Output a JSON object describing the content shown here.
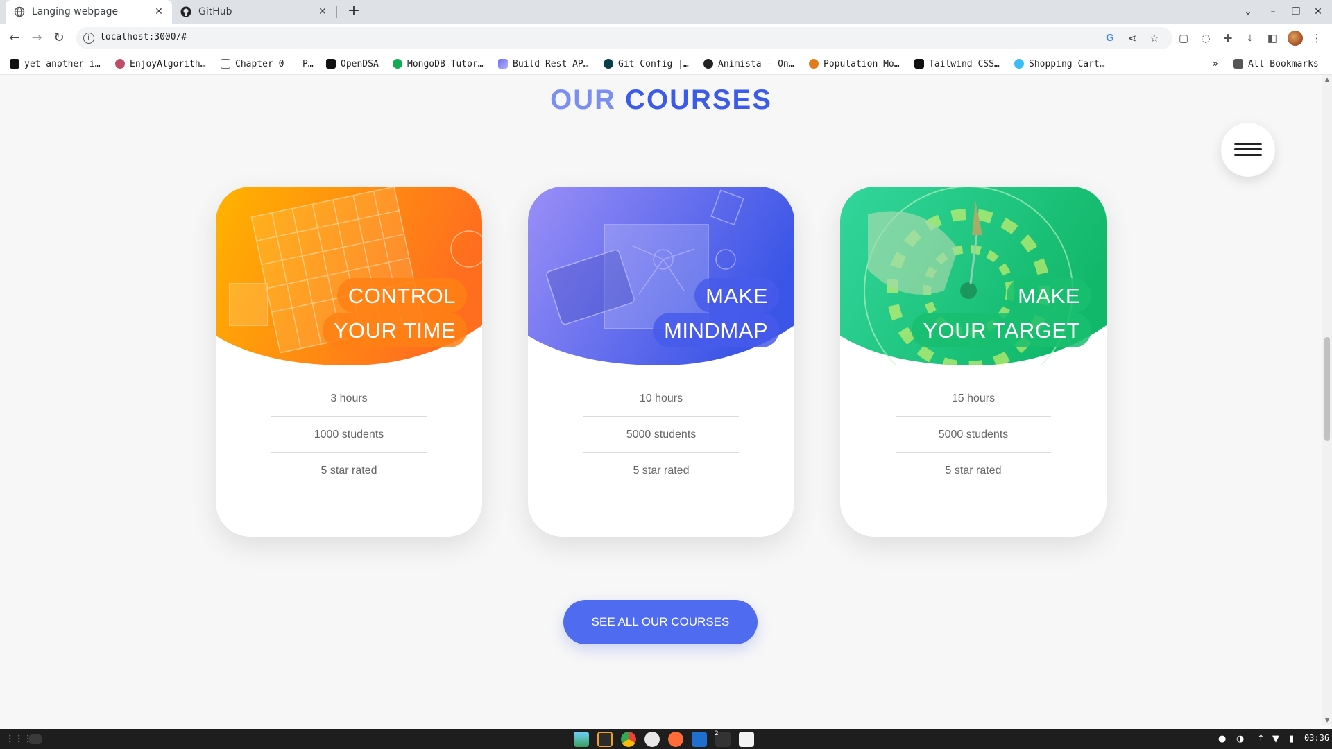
{
  "browser": {
    "tabs": [
      {
        "title": "Langing webpage",
        "active": true
      },
      {
        "title": "GitHub",
        "active": false
      }
    ],
    "url": "localhost:3000/#",
    "bookmarks": [
      "yet another i…",
      "EnjoyAlgorith…",
      "Chapter 0",
      "P…",
      "OpenDSA",
      "MongoDB Tutor…",
      "Build Rest AP…",
      "Git Config |…",
      "Animista - On…",
      "Population Mo…",
      "Tailwind CSS…",
      "Shopping Cart…"
    ],
    "bookmarks_overflow": "»",
    "all_bookmarks": "All Bookmarks"
  },
  "page": {
    "heading_part1": "OUR",
    "heading_part2": "COURSES",
    "cta_label": "SEE ALL OUR COURSES",
    "cards": [
      {
        "title_line1": "CONTROL",
        "title_line2": "YOUR TIME",
        "theme": "orange",
        "colors": [
          "#ffb000",
          "#ff7a1a"
        ],
        "stats": [
          "3 hours",
          "1000 students",
          "5 star rated"
        ]
      },
      {
        "title_line1": "MAKE",
        "title_line2": "MINDMAP",
        "theme": "blue",
        "colors": [
          "#8e8cf5",
          "#3b55e6"
        ],
        "stats": [
          "10 hours",
          "5000 students",
          "5 star rated"
        ]
      },
      {
        "title_line1": "MAKE",
        "title_line2": "YOUR TARGET",
        "theme": "green",
        "colors": [
          "#2ed59a",
          "#15b86b"
        ],
        "stats": [
          "15 hours",
          "5000 students",
          "5 star rated"
        ]
      }
    ]
  },
  "taskbar": {
    "clock": "03:36",
    "badge": "2"
  }
}
